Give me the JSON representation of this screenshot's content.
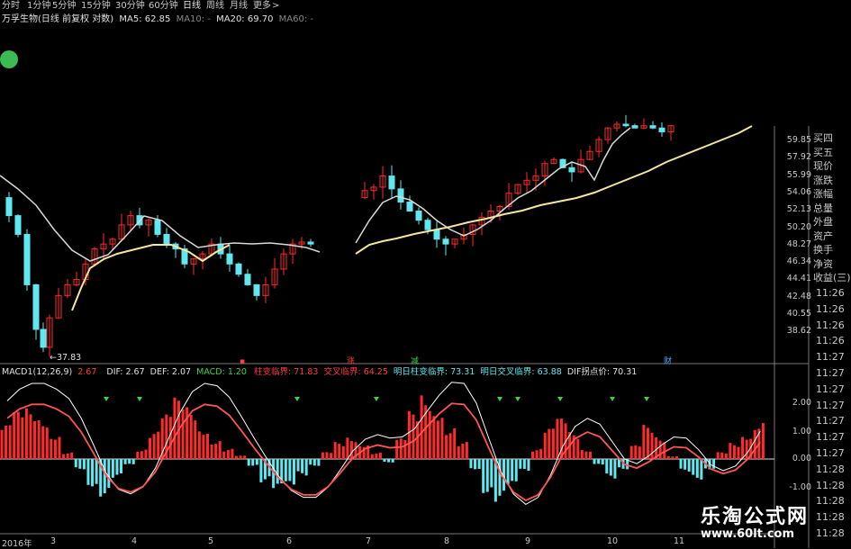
{
  "toolbar": {
    "tabs": [
      "分时",
      "1分钟",
      "5分钟",
      "15分钟",
      "30分钟",
      "60分钟",
      "日线",
      "周线",
      "月线",
      "更多"
    ],
    "active": "日线",
    "more_arrow": ">"
  },
  "header": {
    "stock": "万孚生物(日线 前复权 对数)",
    "ma5": "MA5: 62.85",
    "ma10": "MA10: -",
    "ma20": "MA20: 69.70",
    "ma60": "MA60: -"
  },
  "price_axis": [
    "59.85",
    "57.92",
    "55.99",
    "54.06",
    "52.13",
    "50.20",
    "48.27",
    "46.34",
    "44.41",
    "42.48",
    "40.55",
    "38.62"
  ],
  "right_panel": {
    "labels": [
      "买四",
      "买五",
      "现价",
      "涨跌",
      "涨幅",
      "总量",
      "外盘",
      "资产",
      "换手",
      "净资",
      "收益(三)"
    ],
    "times": [
      "11:26",
      "11:26",
      "11:26",
      "11:26",
      "11:27",
      "11:27",
      "11:27",
      "11:27",
      "11:27",
      "11:27",
      "11:27",
      "11:28",
      "11:28",
      "11:28",
      "11:28",
      "11:28"
    ]
  },
  "annotations": {
    "low_price": "←37.83",
    "markers": [
      "涨",
      "减",
      "财"
    ],
    "marker_colors": [
      "#ff3b3b",
      "#ffffff",
      "#3fd14f",
      "#4aa8ff"
    ]
  },
  "macd": {
    "title": "MACD1(12,26,9)",
    "title_val": "2.67",
    "dif": "DIF: 2.67",
    "def": "DEF: 2.07",
    "macd": "MACD: 1.20",
    "items": [
      "柱变临界: 71.83",
      "交叉临界: 64.25",
      "明日柱变临界: 73.31",
      "明日交叉临界: 63.88",
      "DIF拐点价: 70.31"
    ],
    "axis": [
      "2.00",
      "1.00",
      "0.00",
      "-1.00"
    ]
  },
  "x_axis": [
    "2016年",
    "3",
    "4",
    "5",
    "6",
    "7",
    "8",
    "9",
    "10",
    "11"
  ],
  "watermark": {
    "title": "乐淘公式网",
    "url": "www.60lt.com"
  },
  "colors": {
    "up": "#ff2a2a",
    "down": "#5fe8ef",
    "ma_white": "#d8d8d8",
    "ma_yellow": "#f5e6a0",
    "green": "#3fd14f",
    "dif": "#ffffff",
    "dea": "#ff5555"
  },
  "chart_data": {
    "type": "candlestick",
    "title": "万孚生物(日线 前复权 对数)",
    "price_range": [
      37.83,
      62.0
    ],
    "low_marker": 37.83,
    "macd_range": [
      -1.5,
      2.8
    ],
    "macd_hist": [
      1.0,
      1.4,
      1.5,
      1.3,
      0.8,
      0.2,
      -0.3,
      -0.8,
      -1.1,
      -0.6,
      -0.2,
      0.3,
      0.8,
      1.3,
      1.8,
      1.6,
      1.0,
      0.6,
      0.3,
      0.1,
      -0.2,
      -0.7,
      -1.0,
      -0.9,
      -0.5,
      -0.2,
      0.2,
      0.5,
      0.7,
      0.5,
      0.2,
      -0.1,
      0.6,
      1.4,
      2.0,
      1.6,
      1.0,
      0.5,
      -0.3,
      -1.0,
      -1.3,
      -0.9,
      -0.4,
      0.3,
      0.9,
      1.2,
      0.8,
      0.3,
      -0.2,
      -0.6,
      -0.3,
      0.4,
      1.0,
      0.7,
      0.1,
      -0.4,
      -0.6,
      -0.3,
      0.2,
      0.5,
      0.8,
      1.2
    ]
  }
}
